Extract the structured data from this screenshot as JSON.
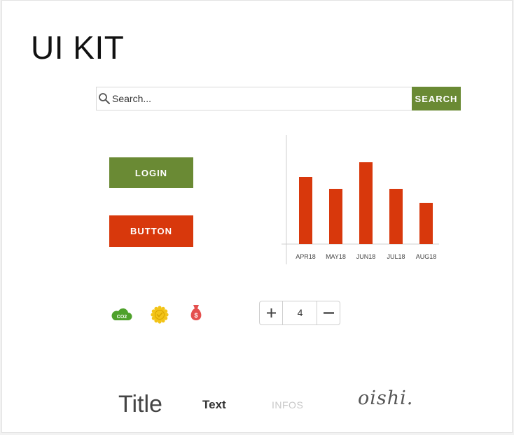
{
  "heading": "UI KIT",
  "search": {
    "placeholder": "Search...",
    "button_label": "SEARCH",
    "icon": "search-icon"
  },
  "buttons": {
    "login_label": "LOGIN",
    "button_label": "BUTTON"
  },
  "colors": {
    "green": "#6a8a34",
    "orange": "#d8380c",
    "bar": "#d8380c",
    "co2_cloud": "#4ea12b",
    "badge": "#f3c417",
    "money_bag": "#e4504e"
  },
  "chart_data": {
    "type": "bar",
    "categories": [
      "APR18",
      "MAY18",
      "JUN18",
      "JUL18",
      "AUG18"
    ],
    "values": [
      96,
      79,
      117,
      79,
      59
    ],
    "ylim": [
      0,
      150
    ],
    "grid": false
  },
  "icons": {
    "co2_label": "CO2",
    "items": [
      "co2-cloud-icon",
      "check-badge-icon",
      "money-bag-icon"
    ]
  },
  "stepper": {
    "value": "4",
    "plus_icon": "plus-icon",
    "minus_icon": "minus-icon"
  },
  "typography": {
    "title": "Title",
    "text": "Text",
    "infos": "INFOS",
    "logo": "oishi."
  }
}
